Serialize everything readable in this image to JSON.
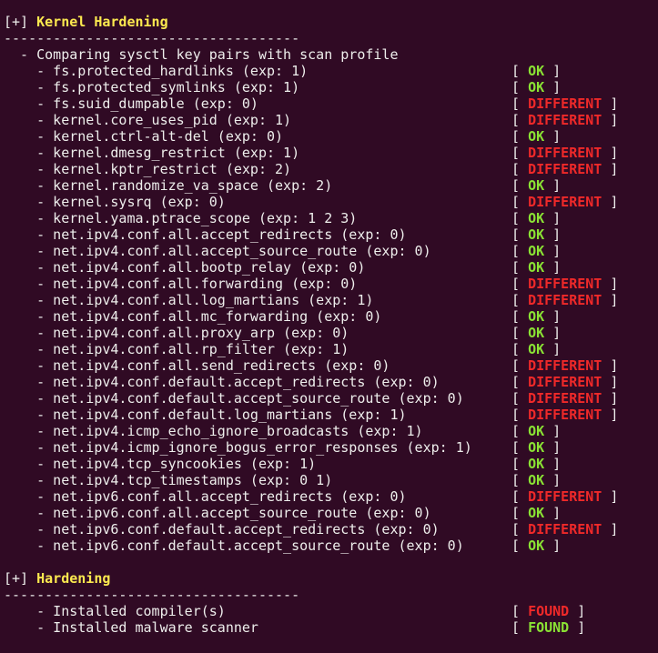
{
  "colors": {
    "background": "#300a24",
    "text": "#eeeeec",
    "header": "#fce94f",
    "ok": "#8ae234",
    "different": "#ef2929"
  },
  "sections": [
    {
      "marker": "[+]",
      "title": "Kernel Hardening",
      "separator": "------------------------------------",
      "intro": "  - Comparing sysctl key pairs with scan profile",
      "items": [
        {
          "text": "    - fs.protected_hardlinks (exp: 1)",
          "status": "OK",
          "state": "ok"
        },
        {
          "text": "    - fs.protected_symlinks (exp: 1)",
          "status": "OK",
          "state": "ok"
        },
        {
          "text": "    - fs.suid_dumpable (exp: 0)",
          "status": "DIFFERENT",
          "state": "diff"
        },
        {
          "text": "    - kernel.core_uses_pid (exp: 1)",
          "status": "DIFFERENT",
          "state": "diff"
        },
        {
          "text": "    - kernel.ctrl-alt-del (exp: 0)",
          "status": "OK",
          "state": "ok"
        },
        {
          "text": "    - kernel.dmesg_restrict (exp: 1)",
          "status": "DIFFERENT",
          "state": "diff"
        },
        {
          "text": "    - kernel.kptr_restrict (exp: 2)",
          "status": "DIFFERENT",
          "state": "diff"
        },
        {
          "text": "    - kernel.randomize_va_space (exp: 2)",
          "status": "OK",
          "state": "ok"
        },
        {
          "text": "    - kernel.sysrq (exp: 0)",
          "status": "DIFFERENT",
          "state": "diff"
        },
        {
          "text": "    - kernel.yama.ptrace_scope (exp: 1 2 3)",
          "status": "OK",
          "state": "ok"
        },
        {
          "text": "    - net.ipv4.conf.all.accept_redirects (exp: 0)",
          "status": "OK",
          "state": "ok"
        },
        {
          "text": "    - net.ipv4.conf.all.accept_source_route (exp: 0)",
          "status": "OK",
          "state": "ok"
        },
        {
          "text": "    - net.ipv4.conf.all.bootp_relay (exp: 0)",
          "status": "OK",
          "state": "ok"
        },
        {
          "text": "    - net.ipv4.conf.all.forwarding (exp: 0)",
          "status": "DIFFERENT",
          "state": "diff"
        },
        {
          "text": "    - net.ipv4.conf.all.log_martians (exp: 1)",
          "status": "DIFFERENT",
          "state": "diff"
        },
        {
          "text": "    - net.ipv4.conf.all.mc_forwarding (exp: 0)",
          "status": "OK",
          "state": "ok"
        },
        {
          "text": "    - net.ipv4.conf.all.proxy_arp (exp: 0)",
          "status": "OK",
          "state": "ok"
        },
        {
          "text": "    - net.ipv4.conf.all.rp_filter (exp: 1)",
          "status": "OK",
          "state": "ok"
        },
        {
          "text": "    - net.ipv4.conf.all.send_redirects (exp: 0)",
          "status": "DIFFERENT",
          "state": "diff"
        },
        {
          "text": "    - net.ipv4.conf.default.accept_redirects (exp: 0)",
          "status": "DIFFERENT",
          "state": "diff"
        },
        {
          "text": "    - net.ipv4.conf.default.accept_source_route (exp: 0)",
          "status": "DIFFERENT",
          "state": "diff"
        },
        {
          "text": "    - net.ipv4.conf.default.log_martians (exp: 1)",
          "status": "DIFFERENT",
          "state": "diff"
        },
        {
          "text": "    - net.ipv4.icmp_echo_ignore_broadcasts (exp: 1)",
          "status": "OK",
          "state": "ok"
        },
        {
          "text": "    - net.ipv4.icmp_ignore_bogus_error_responses (exp: 1)",
          "status": "OK",
          "state": "ok"
        },
        {
          "text": "    - net.ipv4.tcp_syncookies (exp: 1)",
          "status": "OK",
          "state": "ok"
        },
        {
          "text": "    - net.ipv4.tcp_timestamps (exp: 0 1)",
          "status": "OK",
          "state": "ok"
        },
        {
          "text": "    - net.ipv6.conf.all.accept_redirects (exp: 0)",
          "status": "DIFFERENT",
          "state": "diff"
        },
        {
          "text": "    - net.ipv6.conf.all.accept_source_route (exp: 0)",
          "status": "OK",
          "state": "ok"
        },
        {
          "text": "    - net.ipv6.conf.default.accept_redirects (exp: 0)",
          "status": "DIFFERENT",
          "state": "diff"
        },
        {
          "text": "    - net.ipv6.conf.default.accept_source_route (exp: 0)",
          "status": "OK",
          "state": "ok"
        }
      ]
    },
    {
      "marker": "[+]",
      "title": "Hardening",
      "separator": "------------------------------------",
      "intro": "",
      "items": [
        {
          "text": "    - Installed compiler(s)",
          "status": "FOUND",
          "state": "found-red"
        },
        {
          "text": "    - Installed malware scanner",
          "status": "FOUND",
          "state": "found-green"
        }
      ]
    }
  ]
}
